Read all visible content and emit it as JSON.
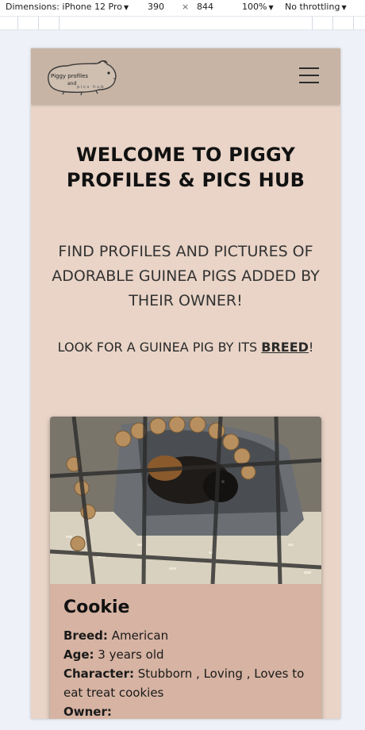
{
  "devtools": {
    "device": "Dimensions: iPhone 12 Pro",
    "width": "390",
    "times": "×",
    "height": "844",
    "zoom": "100%",
    "throttling": "No throttling"
  },
  "site": {
    "logo_text_1": "Piggy profiles",
    "logo_text_2": "and",
    "logo_text_3": "pics hub"
  },
  "hero": {
    "title": "WELCOME TO PIGGY PROFILES & PICS HUB",
    "subtitle": "FIND PROFILES AND PICTURES OF ADORABLE GUINEA PIGS ADDED BY THEIR OWNER!",
    "breed_prefix": "LOOK FOR A GUINEA PIG BY ITS ",
    "breed_link": "BREED",
    "breed_suffix": "!"
  },
  "card": {
    "name": "Cookie",
    "breed_label": "Breed:",
    "breed_value": " American",
    "age_label": "Age:",
    "age_value": " 3 years old",
    "character_label": "Character:",
    "character_value": " Stubborn , Loving , Loves to eat treat cookies",
    "owner_label": "Owner:",
    "owner_value": ""
  },
  "colors": {
    "page_bg": "#e9d4c7",
    "navbar_bg": "#c7b4a4",
    "card_bg": "#d6b3a2"
  },
  "icons": [
    "menu-icon",
    "guinea-pig-logo",
    "caret-down-icon"
  ]
}
